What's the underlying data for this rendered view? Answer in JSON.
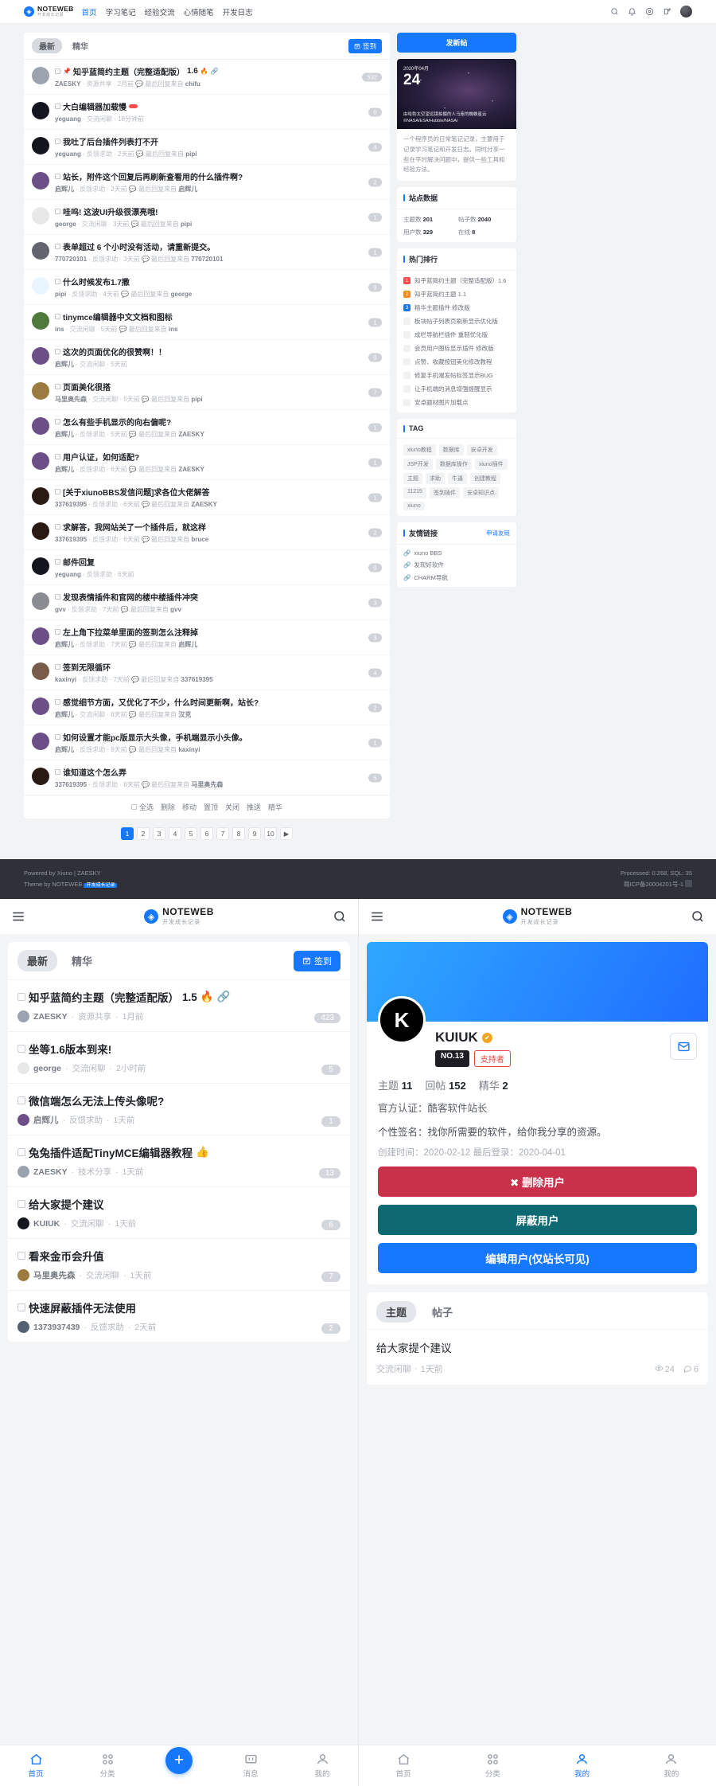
{
  "site": {
    "name": "NOTEWEB",
    "tagline": "开发成长记录",
    "logo_char": "◈",
    "accent": "#1677ff"
  },
  "desktop": {
    "nav": [
      {
        "label": "首页",
        "active": true
      },
      {
        "label": "学习笔记",
        "active": false
      },
      {
        "label": "经验交流",
        "active": false
      },
      {
        "label": "心情随笔",
        "active": false
      },
      {
        "label": "开发日志",
        "active": false
      }
    ],
    "header_icons": [
      "search-icon",
      "bell-icon",
      "compass-icon",
      "compose-icon",
      "avatar"
    ],
    "tabs": [
      {
        "label": "最新",
        "active": true
      },
      {
        "label": "精华",
        "active": false
      }
    ],
    "signin_label": "签到",
    "post_button": "发新帖",
    "threads": [
      {
        "title": "知乎蓝简约主题（完整适配版）",
        "version": "1.6",
        "pinned": true,
        "hot": true,
        "attach": true,
        "user": "ZAESKY",
        "cat": "资源共享",
        "time": "2月前",
        "reply_prefix": "最后回复来自",
        "reply_user": "chifu",
        "count": "532",
        "av": "#9aa3ae"
      },
      {
        "title": "大白编辑器加载慢",
        "tagchip": true,
        "user": "yeguang",
        "cat": "交流闲聊",
        "time": "18分钟前",
        "count": "0",
        "av": "#15161d"
      },
      {
        "title": "我吐了后台插件列表打不开",
        "user": "yeguang",
        "cat": "反馈求助",
        "time": "2天前",
        "reply_prefix": "最后回复来自",
        "reply_user": "pipi",
        "count": "4",
        "av": "#15161d"
      },
      {
        "title": "站长，附件这个回复后再刷新查看用的什么插件啊?",
        "user": "启辉儿",
        "cat": "反馈求助",
        "time": "2天前",
        "reply_prefix": "最后回复来自",
        "reply_user": "启辉儿",
        "count": "2",
        "av": "#6b4f86"
      },
      {
        "title": "哇呜! 这波UI升级很漂亮哦!",
        "user": "george",
        "cat": "交流闲聊",
        "time": "3天前",
        "reply_prefix": "最后回复来自",
        "reply_user": "pipi",
        "count": "1",
        "av": "#e8e8e8"
      },
      {
        "title": "表单超过 6 个小时没有活动，请重新提交。",
        "user": "770720101",
        "cat": "反馈求助",
        "time": "3天前",
        "reply_prefix": "最后回复来自",
        "reply_user": "770720101",
        "count": "1",
        "av": "#62656c"
      },
      {
        "title": "什么时候发布1.7撒",
        "user": "pipi",
        "cat": "反馈求助",
        "time": "4天前",
        "reply_prefix": "最后回复来自",
        "reply_user": "george",
        "count": "9",
        "av": "#eaf6ff"
      },
      {
        "title": "tinymce编辑器中文文档和图标",
        "user": "ins",
        "cat": "交流闲聊",
        "time": "5天前",
        "reply_prefix": "最后回复来自",
        "reply_user": "ins",
        "count": "1",
        "av": "#4e7a3c"
      },
      {
        "title": "这次的页面优化的很赞啊！！",
        "user": "启辉儿",
        "cat": "交流闲聊",
        "time": "5天前",
        "count": "0",
        "av": "#6b4f86"
      },
      {
        "title": "页面美化很搭",
        "user": "马里奥先森",
        "cat": "交流闲聊",
        "time": "5天前",
        "reply_prefix": "最后回复来自",
        "reply_user": "pipi",
        "count": "7",
        "av": "#9b7b3f"
      },
      {
        "title": "怎么有些手机显示的向右偏呢?",
        "user": "启辉儿",
        "cat": "反馈求助",
        "time": "5天前",
        "reply_prefix": "最后回复来自",
        "reply_user": "ZAESKY",
        "count": "1",
        "av": "#6b4f86"
      },
      {
        "title": "用户认证，如何适配?",
        "user": "启辉儿",
        "cat": "反馈求助",
        "time": "6天前",
        "reply_prefix": "最后回复来自",
        "reply_user": "ZAESKY",
        "count": "1",
        "av": "#6b4f86"
      },
      {
        "title": "[关于xiunoBBS发信问题]求各位大佬解答",
        "user": "337619395",
        "cat": "反馈求助",
        "time": "6天前",
        "reply_prefix": "最后回复来自",
        "reply_user": "ZAESKY",
        "count": "1",
        "av": "#2a1a14"
      },
      {
        "title": "求解答，我网站关了一个插件后，就这样",
        "user": "337619395",
        "cat": "反馈求助",
        "time": "6天前",
        "reply_prefix": "最后回复来自",
        "reply_user": "bruce",
        "count": "2",
        "av": "#2a1a14"
      },
      {
        "title": "邮件回复",
        "user": "yeguang",
        "cat": "反馈求助",
        "time": "6天前",
        "count": "0",
        "av": "#15161d"
      },
      {
        "title": "发现表情插件和官网的楼中楼插件冲突",
        "user": "gvv",
        "cat": "反馈求助",
        "time": "7天前",
        "reply_prefix": "最后回复来自",
        "reply_user": "gvv",
        "count": "3",
        "av": "#8b8b92"
      },
      {
        "title": "左上角下拉菜单里面的签到怎么注释掉",
        "user": "启辉儿",
        "cat": "反馈求助",
        "time": "7天前",
        "reply_prefix": "最后回复来自",
        "reply_user": "启辉儿",
        "count": "3",
        "av": "#6b4f86"
      },
      {
        "title": "签到无限循环",
        "user": "kaxinyi",
        "cat": "反馈求助",
        "time": "7天前",
        "reply_prefix": "最后回复来自",
        "reply_user": "337619395",
        "count": "4",
        "av": "#7a5c4a"
      },
      {
        "title": "感觉细节方面，又优化了不少，什么时间更新啊，站长?",
        "user": "启辉儿",
        "cat": "交流闲聊",
        "time": "8天前",
        "reply_prefix": "最后回复来自",
        "reply_user": "汉克",
        "count": "2",
        "av": "#6b4f86"
      },
      {
        "title": "如何设置才能pc版显示大头像，手机端显示小头像。",
        "user": "启辉儿",
        "cat": "反馈求助",
        "time": "8天前",
        "reply_prefix": "最后回复来自",
        "reply_user": "kaxinyi",
        "count": "1",
        "av": "#6b4f86"
      },
      {
        "title": "谁知道这个怎么弄",
        "user": "337619395",
        "cat": "反馈求助",
        "time": "8天前",
        "reply_prefix": "最后回复来自",
        "reply_user": "马里奥先森",
        "count": "5",
        "av": "#2a1a14"
      }
    ],
    "select_bar": {
      "select_all": "全选",
      "actions": [
        "删除",
        "移动",
        "置顶",
        "关闭",
        "推送",
        "精华"
      ]
    },
    "pagination": {
      "pages": [
        "1",
        "2",
        "3",
        "4",
        "5",
        "6",
        "7",
        "8",
        "9",
        "10"
      ],
      "current": "1",
      "next": "▶"
    },
    "sidebar": {
      "promo": {
        "year_month": "2020年04月",
        "day": "24",
        "caption": "由哈勃太空望远镜拍摄的人马座的蜘蛛星云 ©NASA/ESA/Hubble/NASA/",
        "text": "一个程序员的日常笔记记录，主要用于记录学习笔记和开发日志。同时分享一些在平时解决问题中，提供一些工具和经验方法。"
      },
      "stats": {
        "title": "站点数据",
        "items": [
          {
            "label": "主题数",
            "value": "201"
          },
          {
            "label": "帖子数",
            "value": "2040"
          },
          {
            "label": "用户数",
            "value": "329"
          },
          {
            "label": "在线",
            "value": "8"
          }
        ]
      },
      "rank": {
        "title": "热门排行",
        "items": [
          {
            "no": "1",
            "label": "知乎蓝简约主题（完整适配版）1.6"
          },
          {
            "no": "2",
            "label": "知乎蓝简约主题 1.1"
          },
          {
            "no": "3",
            "label": "精华主题插件 修改版"
          },
          {
            "no": "",
            "label": "板块帖子列表页刷新显示优化版"
          },
          {
            "no": "",
            "label": "成栏导航栏插件 重制优化版"
          },
          {
            "no": "",
            "label": "会员用户图标显示插件 修改版"
          },
          {
            "no": "",
            "label": "点赞、收藏按钮美化修改教程"
          },
          {
            "no": "",
            "label": "修复手机端发帖标签显示BUG"
          },
          {
            "no": "",
            "label": "让手机端的消息增强提醒显示"
          },
          {
            "no": "",
            "label": "安卓题材图片加载点"
          }
        ]
      },
      "tags": {
        "title": "TAG",
        "items": [
          "xiuno教程",
          "数据库",
          "安卓开发",
          "JSP开发",
          "数据库操作",
          "xiuno插件",
          "主题",
          "求助",
          "牛逼",
          "创建教程",
          "11215",
          "签到插件",
          "安卓知识点",
          "xiuno"
        ]
      },
      "links": {
        "title": "友情链接",
        "apply": "申请友链",
        "items": [
          "xiuno BBS",
          "发现好软件",
          "CHARM导航"
        ]
      }
    },
    "footer": {
      "powered": "Powered by Xiuno | ZAESKY",
      "theme": "Theme by NOTEWEB",
      "theme_badge": "开发成长记录",
      "processed": "Processed: 0.268, SQL: 35",
      "icp": "赣ICP备20004201号-1"
    }
  },
  "mobile_left": {
    "tabs": [
      {
        "label": "最新",
        "active": true
      },
      {
        "label": "精华",
        "active": false
      }
    ],
    "signin_label": "签到",
    "threads": [
      {
        "title": "知乎蓝简约主题（完整适配版）",
        "version": "1.5",
        "hot": true,
        "attach": true,
        "user": "ZAESKY",
        "cat": "资源共享",
        "time": "1月前",
        "count": "423",
        "av": "#9aa3ae"
      },
      {
        "title": "坐等1.6版本到来!",
        "user": "george",
        "cat": "交流闲聊",
        "time": "2小时前",
        "count": "5",
        "av": "#e8e8e8"
      },
      {
        "title": "微信端怎么无法上传头像呢?",
        "user": "启辉儿",
        "cat": "反馈求助",
        "time": "1天前",
        "count": "1",
        "av": "#6b4f86"
      },
      {
        "title": "兔兔插件适配TinyMCE编辑器教程",
        "thumb": true,
        "user": "ZAESKY",
        "cat": "技术分享",
        "time": "1天前",
        "count": "13",
        "av": "#9aa3ae"
      },
      {
        "title": "给大家提个建议",
        "user": "KUIUK",
        "cat": "交流闲聊",
        "time": "1天前",
        "count": "6",
        "av": "#15161d"
      },
      {
        "title": "看来金币会升值",
        "user": "马里奥先森",
        "cat": "交流闲聊",
        "time": "1天前",
        "count": "7",
        "av": "#9b7b3f"
      },
      {
        "title": "快速屏蔽插件无法使用",
        "user": "1373937439",
        "cat": "反馈求助",
        "time": "2天前",
        "count": "2",
        "av": "#556070"
      }
    ],
    "tabbar": [
      {
        "label": "首页",
        "icon": "home-icon",
        "active": true
      },
      {
        "label": "分类",
        "icon": "grid-icon",
        "active": false
      },
      {
        "label": "",
        "icon": "plus-icon",
        "fab": true
      },
      {
        "label": "消息",
        "icon": "message-icon",
        "active": false
      },
      {
        "label": "我的",
        "icon": "user-icon",
        "active": false
      }
    ]
  },
  "mobile_right": {
    "profile": {
      "initial": "K",
      "name": "KUIUK",
      "verified_icon": "verified-badge-icon",
      "rank_no": "NO.13",
      "supporter": "支持者",
      "stats": [
        {
          "label": "主题",
          "value": "11"
        },
        {
          "label": "回帖",
          "value": "152"
        },
        {
          "label": "精华",
          "value": "2"
        }
      ],
      "official_label": "官方认证：",
      "official_value": "酷客软件站长",
      "signature_label": "个性签名：",
      "signature_value": "找你所需要的软件，给你我分享的资源。",
      "created_label": "创建时间：",
      "created_value": "2020-02-12",
      "last_login_label": "最后登录：",
      "last_login_value": "2020-04-01",
      "buttons": [
        {
          "label": "✖ 删除用户",
          "style": "red"
        },
        {
          "label": "屏蔽用户",
          "style": "teal"
        },
        {
          "label": "编辑用户(仅站长可见)",
          "style": "blue"
        }
      ]
    },
    "segments": [
      {
        "label": "主题",
        "active": true
      },
      {
        "label": "帖子",
        "active": false
      }
    ],
    "items": [
      {
        "title": "给大家提个建议",
        "cat": "交流闲聊",
        "time": "1天前",
        "views": "24",
        "replies": "6"
      }
    ],
    "tabbar": [
      {
        "label": "首页",
        "icon": "home-icon",
        "active": false
      },
      {
        "label": "分类",
        "icon": "grid-icon",
        "active": false
      },
      {
        "label": "我的",
        "icon": "user-icon",
        "active": true
      },
      {
        "label": "我的",
        "icon": "user-icon",
        "active": false
      }
    ]
  }
}
